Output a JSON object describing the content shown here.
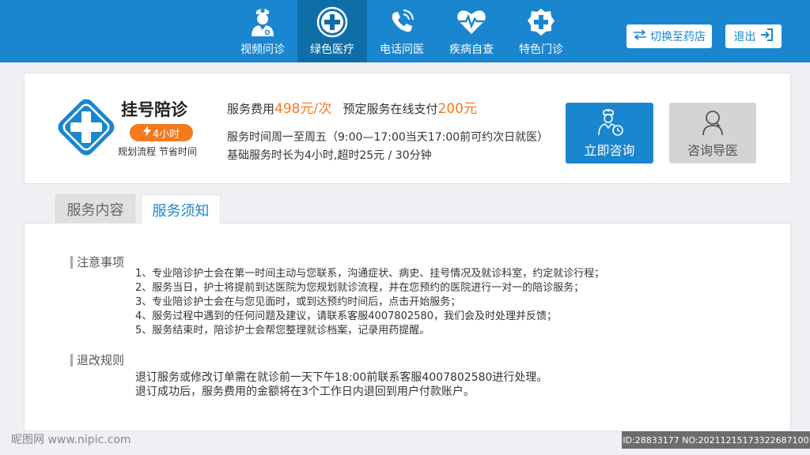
{
  "nav": {
    "items": [
      {
        "label": "视频问诊",
        "icon": "doctor-icon"
      },
      {
        "label": "绿色医疗",
        "icon": "plus-circle-icon"
      },
      {
        "label": "电话问医",
        "icon": "phone-icon"
      },
      {
        "label": "疾病自查",
        "icon": "heartbeat-icon"
      },
      {
        "label": "特色门诊",
        "icon": "medical-cross-badge-icon"
      }
    ],
    "active_index": 1
  },
  "header": {
    "switch_label": "切换至药店",
    "logout_label": "退出"
  },
  "service": {
    "title": "挂号陪诊",
    "badge": "4小时",
    "tagline": "规划流程 节省时间",
    "fee_prefix": "服务费用",
    "fee_value": "498元/次",
    "prepay_prefix": "预定服务在线支付",
    "prepay_value": "200元",
    "hours": "服务时间周一至周五（9:00—17:00当天17:00前可约次日就医）",
    "base": "基础服务时长为4小时,超时25元 / 30分钟",
    "consult_label": "立即咨询",
    "guide_label": "咨询导医"
  },
  "tabs": {
    "content_label": "服务内容",
    "notice_label": "服务须知",
    "active": "notice"
  },
  "notice": {
    "title": "注意事项",
    "items": [
      "1、专业陪诊护士会在第一时间主动与您联系，沟通症状、病史、挂号情况及就诊科室，约定就诊行程；",
      "2、服务当日，护士将提前到达医院为您规划就诊流程，并在您预约的医院进行一对一的陪诊服务；",
      "3、专业陪诊护士会在与您见面时，或到达预约时间后，点击开始服务；",
      "4、服务过程中遇到的任何问题及建议，请联系客服4007802580，我们会及时处理并反馈；",
      "5、服务结束时，陪诊护士会帮您整理就诊档案，记录用药提醒。"
    ]
  },
  "refund": {
    "title": "退改规则",
    "lines": [
      "退订服务或修改订单需在就诊前一天下午18:00前联系客服4007802580进行处理。",
      "退订成功后，服务费用的金额将在3个工作日内退回到用户付款账户。"
    ]
  },
  "watermark": {
    "left": "昵图网 www.nipic.com",
    "right": "ID:28833177 NO:20211215173322687100"
  },
  "colors": {
    "primary": "#1a86cf",
    "primary_dark": "#0f6ea8",
    "accent": "#f47a1f"
  }
}
